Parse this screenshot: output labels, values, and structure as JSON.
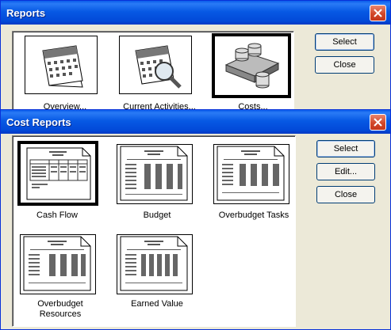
{
  "reports_window": {
    "title": "Reports",
    "tiles": [
      {
        "label": "Overview..."
      },
      {
        "label": "Current Activities..."
      },
      {
        "label": "Costs..."
      }
    ],
    "buttons": {
      "select": "Select",
      "close": "Close"
    }
  },
  "cost_window": {
    "title": "Cost Reports",
    "tiles": [
      {
        "label": "Cash Flow"
      },
      {
        "label": "Budget"
      },
      {
        "label": "Overbudget Tasks"
      },
      {
        "label": "Overbudget Resources"
      },
      {
        "label": "Earned Value"
      }
    ],
    "buttons": {
      "select": "Select",
      "edit": "Edit...",
      "close": "Close"
    }
  },
  "colors": {
    "titlebar": "#0a5bea",
    "dialog_bg": "#ece9d8",
    "close_button": "#d2482a"
  }
}
